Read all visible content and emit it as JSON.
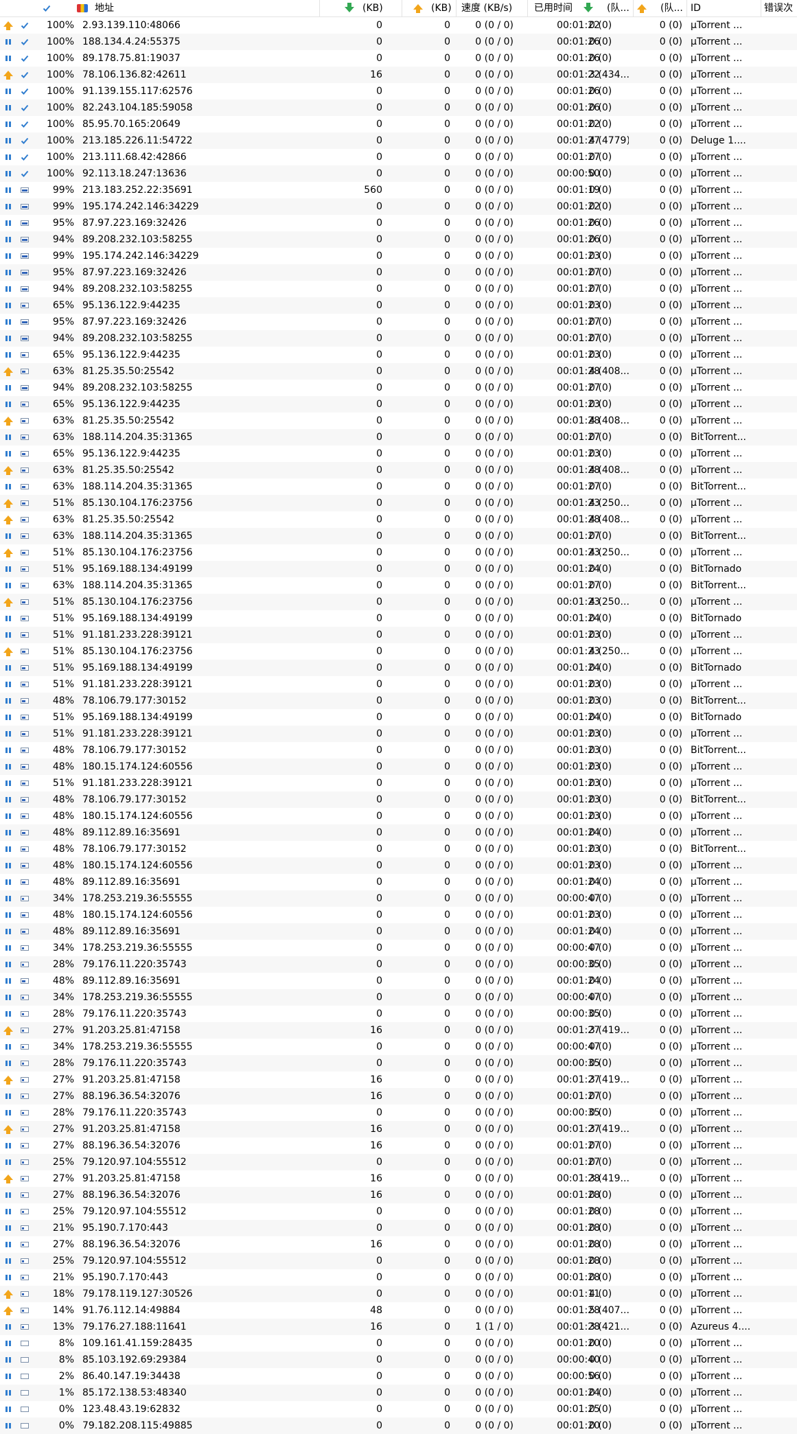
{
  "header": {
    "address": "地址",
    "down_kb": "(KB)",
    "up_kb": "(KB)",
    "speed": "速度 (KB/s)",
    "elapsed": "已用时间",
    "down_queue": "(队...",
    "up_queue": "(队...",
    "id": "ID",
    "errors": "错误次"
  },
  "rows": [
    [
      "up",
      "done",
      "100%",
      "2.93.139.110:48066",
      "0",
      "0",
      "0 (0 / 0)",
      "00:01:22",
      "0 (0)",
      "0 (0)",
      "µTorrent ..."
    ],
    [
      "pause",
      "done",
      "100%",
      "188.134.4.24:55375",
      "0",
      "0",
      "0 (0 / 0)",
      "00:01:26",
      "0 (0)",
      "0 (0)",
      "µTorrent ..."
    ],
    [
      "pause",
      "done",
      "100%",
      "89.178.75.81:19037",
      "0",
      "0",
      "0 (0 / 0)",
      "00:01:26",
      "0 (0)",
      "0 (0)",
      "µTorrent ..."
    ],
    [
      "up",
      "done",
      "100%",
      "78.106.136.82:42611",
      "16",
      "0",
      "0 (0 / 0)",
      "00:01:22",
      "3 (434...",
      "0 (0)",
      "µTorrent ..."
    ],
    [
      "pause",
      "done",
      "100%",
      "91.139.155.117:62576",
      "0",
      "0",
      "0 (0 / 0)",
      "00:01:26",
      "0 (0)",
      "0 (0)",
      "µTorrent ..."
    ],
    [
      "pause",
      "done",
      "100%",
      "82.243.104.185:59058",
      "0",
      "0",
      "0 (0 / 0)",
      "00:01:26",
      "0 (0)",
      "0 (0)",
      "µTorrent ..."
    ],
    [
      "pause",
      "done",
      "100%",
      "85.95.70.165:20649",
      "0",
      "0",
      "0 (0 / 0)",
      "00:01:22",
      "0 (0)",
      "0 (0)",
      "µTorrent ..."
    ],
    [
      "pause",
      "done",
      "100%",
      "213.185.226.11:54722",
      "0",
      "0",
      "0 (0 / 0)",
      "00:01:27",
      "4 (4779)",
      "0 (0)",
      "Deluge 1...."
    ],
    [
      "pause",
      "done",
      "100%",
      "213.111.68.42:42866",
      "0",
      "0",
      "0 (0 / 0)",
      "00:01:27",
      "0 (0)",
      "0 (0)",
      "µTorrent ..."
    ],
    [
      "pause",
      "done",
      "100%",
      "92.113.18.247:13636",
      "0",
      "0",
      "0 (0 / 0)",
      "00:00:50",
      "0 (0)",
      "0 (0)",
      "µTorrent ..."
    ],
    [
      "pause",
      "part",
      "99%",
      "213.183.252.22:35691",
      "560",
      "0",
      "0 (0 / 0)",
      "00:01:19",
      "0 (0)",
      "0 (0)",
      "µTorrent ..."
    ],
    [
      "pause",
      "part",
      "99%",
      "195.174.242.146:34229",
      "0",
      "0",
      "0 (0 / 0)",
      "00:01:22",
      "0 (0)",
      "0 (0)",
      "µTorrent ..."
    ],
    [
      "pause",
      "part",
      "95%",
      "87.97.223.169:32426",
      "0",
      "0",
      "0 (0 / 0)",
      "00:01:26",
      "0 (0)",
      "0 (0)",
      "µTorrent ..."
    ],
    [
      "pause",
      "part",
      "94%",
      "89.208.232.103:58255",
      "0",
      "0",
      "0 (0 / 0)",
      "00:01:26",
      "0 (0)",
      "0 (0)",
      "µTorrent ..."
    ],
    [
      "pause",
      "part",
      "99%",
      "195.174.242.146:34229",
      "0",
      "0",
      "0 (0 / 0)",
      "00:01:23",
      "0 (0)",
      "0 (0)",
      "µTorrent ..."
    ],
    [
      "pause",
      "part",
      "95%",
      "87.97.223.169:32426",
      "0",
      "0",
      "0 (0 / 0)",
      "00:01:27",
      "0 (0)",
      "0 (0)",
      "µTorrent ..."
    ],
    [
      "pause",
      "part",
      "94%",
      "89.208.232.103:58255",
      "0",
      "0",
      "0 (0 / 0)",
      "00:01:27",
      "0 (0)",
      "0 (0)",
      "µTorrent ..."
    ],
    [
      "pause",
      "mid",
      "65%",
      "95.136.122.9:44235",
      "0",
      "0",
      "0 (0 / 0)",
      "00:01:23",
      "0 (0)",
      "0 (0)",
      "µTorrent ..."
    ],
    [
      "pause",
      "part",
      "95%",
      "87.97.223.169:32426",
      "0",
      "0",
      "0 (0 / 0)",
      "00:01:27",
      "0 (0)",
      "0 (0)",
      "µTorrent ..."
    ],
    [
      "pause",
      "part",
      "94%",
      "89.208.232.103:58255",
      "0",
      "0",
      "0 (0 / 0)",
      "00:01:27",
      "0 (0)",
      "0 (0)",
      "µTorrent ..."
    ],
    [
      "pause",
      "mid",
      "65%",
      "95.136.122.9:44235",
      "0",
      "0",
      "0 (0 / 0)",
      "00:01:23",
      "0 (0)",
      "0 (0)",
      "µTorrent ..."
    ],
    [
      "up",
      "mid",
      "63%",
      "81.25.35.50:25542",
      "0",
      "0",
      "0 (0 / 0)",
      "00:01:28",
      "4 (408...",
      "0 (0)",
      "µTorrent ..."
    ],
    [
      "pause",
      "part",
      "94%",
      "89.208.232.103:58255",
      "0",
      "0",
      "0 (0 / 0)",
      "00:01:27",
      "0 (0)",
      "0 (0)",
      "µTorrent ..."
    ],
    [
      "pause",
      "mid",
      "65%",
      "95.136.122.9:44235",
      "0",
      "0",
      "0 (0 / 0)",
      "00:01:23",
      "0 (0)",
      "0 (0)",
      "µTorrent ..."
    ],
    [
      "up",
      "mid",
      "63%",
      "81.25.35.50:25542",
      "0",
      "0",
      "0 (0 / 0)",
      "00:01:28",
      "4 (408...",
      "0 (0)",
      "µTorrent ..."
    ],
    [
      "pause",
      "mid",
      "63%",
      "188.114.204.35:31365",
      "0",
      "0",
      "0 (0 / 0)",
      "00:01:27",
      "0 (0)",
      "0 (0)",
      "BitTorrent..."
    ],
    [
      "pause",
      "mid",
      "65%",
      "95.136.122.9:44235",
      "0",
      "0",
      "0 (0 / 0)",
      "00:01:23",
      "0 (0)",
      "0 (0)",
      "µTorrent ..."
    ],
    [
      "up",
      "mid",
      "63%",
      "81.25.35.50:25542",
      "0",
      "0",
      "0 (0 / 0)",
      "00:01:28",
      "4 (408...",
      "0 (0)",
      "µTorrent ..."
    ],
    [
      "pause",
      "mid",
      "63%",
      "188.114.204.35:31365",
      "0",
      "0",
      "0 (0 / 0)",
      "00:01:27",
      "0 (0)",
      "0 (0)",
      "BitTorrent..."
    ],
    [
      "up",
      "mid",
      "51%",
      "85.130.104.176:23756",
      "0",
      "0",
      "0 (0 / 0)",
      "00:01:23",
      "4 (250...",
      "0 (0)",
      "µTorrent ..."
    ],
    [
      "up",
      "mid",
      "63%",
      "81.25.35.50:25542",
      "0",
      "0",
      "0 (0 / 0)",
      "00:01:28",
      "4 (408...",
      "0 (0)",
      "µTorrent ..."
    ],
    [
      "pause",
      "mid",
      "63%",
      "188.114.204.35:31365",
      "0",
      "0",
      "0 (0 / 0)",
      "00:01:27",
      "0 (0)",
      "0 (0)",
      "BitTorrent..."
    ],
    [
      "up",
      "mid",
      "51%",
      "85.130.104.176:23756",
      "0",
      "0",
      "0 (0 / 0)",
      "00:01:23",
      "4 (250...",
      "0 (0)",
      "µTorrent ..."
    ],
    [
      "pause",
      "mid",
      "51%",
      "95.169.188.134:49199",
      "0",
      "0",
      "0 (0 / 0)",
      "00:01:24",
      "0 (0)",
      "0 (0)",
      "BitTornado"
    ],
    [
      "pause",
      "mid",
      "63%",
      "188.114.204.35:31365",
      "0",
      "0",
      "0 (0 / 0)",
      "00:01:27",
      "0 (0)",
      "0 (0)",
      "BitTorrent..."
    ],
    [
      "up",
      "mid",
      "51%",
      "85.130.104.176:23756",
      "0",
      "0",
      "0 (0 / 0)",
      "00:01:23",
      "4 (250...",
      "0 (0)",
      "µTorrent ..."
    ],
    [
      "pause",
      "mid",
      "51%",
      "95.169.188.134:49199",
      "0",
      "0",
      "0 (0 / 0)",
      "00:01:24",
      "0 (0)",
      "0 (0)",
      "BitTornado"
    ],
    [
      "pause",
      "mid",
      "51%",
      "91.181.233.228:39121",
      "0",
      "0",
      "0 (0 / 0)",
      "00:01:23",
      "0 (0)",
      "0 (0)",
      "µTorrent ..."
    ],
    [
      "up",
      "mid",
      "51%",
      "85.130.104.176:23756",
      "0",
      "0",
      "0 (0 / 0)",
      "00:01:23",
      "4 (250...",
      "0 (0)",
      "µTorrent ..."
    ],
    [
      "pause",
      "mid",
      "51%",
      "95.169.188.134:49199",
      "0",
      "0",
      "0 (0 / 0)",
      "00:01:24",
      "0 (0)",
      "0 (0)",
      "BitTornado"
    ],
    [
      "pause",
      "mid",
      "51%",
      "91.181.233.228:39121",
      "0",
      "0",
      "0 (0 / 0)",
      "00:01:23",
      "0 (0)",
      "0 (0)",
      "µTorrent ..."
    ],
    [
      "pause",
      "mid",
      "48%",
      "78.106.79.177:30152",
      "0",
      "0",
      "0 (0 / 0)",
      "00:01:23",
      "0 (0)",
      "0 (0)",
      "BitTorrent..."
    ],
    [
      "pause",
      "mid",
      "51%",
      "95.169.188.134:49199",
      "0",
      "0",
      "0 (0 / 0)",
      "00:01:24",
      "0 (0)",
      "0 (0)",
      "BitTornado"
    ],
    [
      "pause",
      "mid",
      "51%",
      "91.181.233.228:39121",
      "0",
      "0",
      "0 (0 / 0)",
      "00:01:23",
      "0 (0)",
      "0 (0)",
      "µTorrent ..."
    ],
    [
      "pause",
      "mid",
      "48%",
      "78.106.79.177:30152",
      "0",
      "0",
      "0 (0 / 0)",
      "00:01:23",
      "0 (0)",
      "0 (0)",
      "BitTorrent..."
    ],
    [
      "pause",
      "mid",
      "48%",
      "180.15.174.124:60556",
      "0",
      "0",
      "0 (0 / 0)",
      "00:01:23",
      "0 (0)",
      "0 (0)",
      "µTorrent ..."
    ],
    [
      "pause",
      "mid",
      "51%",
      "91.181.233.228:39121",
      "0",
      "0",
      "0 (0 / 0)",
      "00:01:23",
      "0 (0)",
      "0 (0)",
      "µTorrent ..."
    ],
    [
      "pause",
      "mid",
      "48%",
      "78.106.79.177:30152",
      "0",
      "0",
      "0 (0 / 0)",
      "00:01:23",
      "0 (0)",
      "0 (0)",
      "BitTorrent..."
    ],
    [
      "pause",
      "mid",
      "48%",
      "180.15.174.124:60556",
      "0",
      "0",
      "0 (0 / 0)",
      "00:01:23",
      "0 (0)",
      "0 (0)",
      "µTorrent ..."
    ],
    [
      "pause",
      "mid",
      "48%",
      "89.112.89.16:35691",
      "0",
      "0",
      "0 (0 / 0)",
      "00:01:24",
      "0 (0)",
      "0 (0)",
      "µTorrent ..."
    ],
    [
      "pause",
      "mid",
      "48%",
      "78.106.79.177:30152",
      "0",
      "0",
      "0 (0 / 0)",
      "00:01:23",
      "0 (0)",
      "0 (0)",
      "BitTorrent..."
    ],
    [
      "pause",
      "mid",
      "48%",
      "180.15.174.124:60556",
      "0",
      "0",
      "0 (0 / 0)",
      "00:01:23",
      "0 (0)",
      "0 (0)",
      "µTorrent ..."
    ],
    [
      "pause",
      "mid",
      "48%",
      "89.112.89.16:35691",
      "0",
      "0",
      "0 (0 / 0)",
      "00:01:24",
      "0 (0)",
      "0 (0)",
      "µTorrent ..."
    ],
    [
      "pause",
      "low",
      "34%",
      "178.253.219.36:55555",
      "0",
      "0",
      "0 (0 / 0)",
      "00:00:47",
      "0 (0)",
      "0 (0)",
      "µTorrent ..."
    ],
    [
      "pause",
      "mid",
      "48%",
      "180.15.174.124:60556",
      "0",
      "0",
      "0 (0 / 0)",
      "00:01:23",
      "0 (0)",
      "0 (0)",
      "µTorrent ..."
    ],
    [
      "pause",
      "mid",
      "48%",
      "89.112.89.16:35691",
      "0",
      "0",
      "0 (0 / 0)",
      "00:01:24",
      "0 (0)",
      "0 (0)",
      "µTorrent ..."
    ],
    [
      "pause",
      "low",
      "34%",
      "178.253.219.36:55555",
      "0",
      "0",
      "0 (0 / 0)",
      "00:00:47",
      "0 (0)",
      "0 (0)",
      "µTorrent ..."
    ],
    [
      "pause",
      "low",
      "28%",
      "79.176.11.220:35743",
      "0",
      "0",
      "0 (0 / 0)",
      "00:00:35",
      "0 (0)",
      "0 (0)",
      "µTorrent ..."
    ],
    [
      "pause",
      "mid",
      "48%",
      "89.112.89.16:35691",
      "0",
      "0",
      "0 (0 / 0)",
      "00:01:24",
      "0 (0)",
      "0 (0)",
      "µTorrent ..."
    ],
    [
      "pause",
      "low",
      "34%",
      "178.253.219.36:55555",
      "0",
      "0",
      "0 (0 / 0)",
      "00:00:47",
      "0 (0)",
      "0 (0)",
      "µTorrent ..."
    ],
    [
      "pause",
      "low",
      "28%",
      "79.176.11.220:35743",
      "0",
      "0",
      "0 (0 / 0)",
      "00:00:35",
      "0 (0)",
      "0 (0)",
      "µTorrent ..."
    ],
    [
      "up",
      "low",
      "27%",
      "91.203.25.81:47158",
      "16",
      "0",
      "0 (0 / 0)",
      "00:01:27",
      "3 (419...",
      "0 (0)",
      "µTorrent ..."
    ],
    [
      "pause",
      "low",
      "34%",
      "178.253.219.36:55555",
      "0",
      "0",
      "0 (0 / 0)",
      "00:00:47",
      "0 (0)",
      "0 (0)",
      "µTorrent ..."
    ],
    [
      "pause",
      "low",
      "28%",
      "79.176.11.220:35743",
      "0",
      "0",
      "0 (0 / 0)",
      "00:00:35",
      "0 (0)",
      "0 (0)",
      "µTorrent ..."
    ],
    [
      "up",
      "low",
      "27%",
      "91.203.25.81:47158",
      "16",
      "0",
      "0 (0 / 0)",
      "00:01:27",
      "3 (419...",
      "0 (0)",
      "µTorrent ..."
    ],
    [
      "pause",
      "low",
      "27%",
      "88.196.36.54:32076",
      "16",
      "0",
      "0 (0 / 0)",
      "00:01:27",
      "0 (0)",
      "0 (0)",
      "µTorrent ..."
    ],
    [
      "pause",
      "low",
      "28%",
      "79.176.11.220:35743",
      "0",
      "0",
      "0 (0 / 0)",
      "00:00:35",
      "0 (0)",
      "0 (0)",
      "µTorrent ..."
    ],
    [
      "up",
      "low",
      "27%",
      "91.203.25.81:47158",
      "16",
      "0",
      "0 (0 / 0)",
      "00:01:27",
      "3 (419...",
      "0 (0)",
      "µTorrent ..."
    ],
    [
      "pause",
      "low",
      "27%",
      "88.196.36.54:32076",
      "16",
      "0",
      "0 (0 / 0)",
      "00:01:27",
      "0 (0)",
      "0 (0)",
      "µTorrent ..."
    ],
    [
      "pause",
      "low",
      "25%",
      "79.120.97.104:55512",
      "0",
      "0",
      "0 (0 / 0)",
      "00:01:27",
      "0 (0)",
      "0 (0)",
      "µTorrent ..."
    ],
    [
      "up",
      "low",
      "27%",
      "91.203.25.81:47158",
      "16",
      "0",
      "0 (0 / 0)",
      "00:01:28",
      "3 (419...",
      "0 (0)",
      "µTorrent ..."
    ],
    [
      "pause",
      "low",
      "27%",
      "88.196.36.54:32076",
      "16",
      "0",
      "0 (0 / 0)",
      "00:01:28",
      "0 (0)",
      "0 (0)",
      "µTorrent ..."
    ],
    [
      "pause",
      "low",
      "25%",
      "79.120.97.104:55512",
      "0",
      "0",
      "0 (0 / 0)",
      "00:01:28",
      "0 (0)",
      "0 (0)",
      "µTorrent ..."
    ],
    [
      "pause",
      "low",
      "21%",
      "95.190.7.170:443",
      "0",
      "0",
      "0 (0 / 0)",
      "00:01:28",
      "0 (0)",
      "0 (0)",
      "µTorrent ..."
    ],
    [
      "pause",
      "low",
      "27%",
      "88.196.36.54:32076",
      "16",
      "0",
      "0 (0 / 0)",
      "00:01:28",
      "0 (0)",
      "0 (0)",
      "µTorrent ..."
    ],
    [
      "pause",
      "low",
      "25%",
      "79.120.97.104:55512",
      "0",
      "0",
      "0 (0 / 0)",
      "00:01:28",
      "0 (0)",
      "0 (0)",
      "µTorrent ..."
    ],
    [
      "pause",
      "low",
      "21%",
      "95.190.7.170:443",
      "0",
      "0",
      "0 (0 / 0)",
      "00:01:28",
      "0 (0)",
      "0 (0)",
      "µTorrent ..."
    ],
    [
      "up",
      "low",
      "18%",
      "79.178.119.127:30526",
      "0",
      "0",
      "0 (0 / 0)",
      "00:01:11",
      "4 (0)",
      "0 (0)",
      "µTorrent ..."
    ],
    [
      "up",
      "low",
      "14%",
      "91.76.112.14:49884",
      "48",
      "0",
      "0 (0 / 0)",
      "00:01:28",
      "5 (407...",
      "0 (0)",
      "µTorrent ..."
    ],
    [
      "pause",
      "low",
      "13%",
      "79.176.27.188:11641",
      "16",
      "0",
      "1 (1 / 0)",
      "00:01:28",
      "3 (421...",
      "0 (0)",
      "Azureus 4...."
    ],
    [
      "pause",
      "empty",
      "8%",
      "109.161.41.159:28435",
      "0",
      "0",
      "0 (0 / 0)",
      "00:01:20",
      "0 (0)",
      "0 (0)",
      "µTorrent ..."
    ],
    [
      "pause",
      "empty",
      "8%",
      "85.103.192.69:29384",
      "0",
      "0",
      "0 (0 / 0)",
      "00:00:40",
      "0 (0)",
      "0 (0)",
      "µTorrent ..."
    ],
    [
      "pause",
      "empty",
      "2%",
      "86.40.147.19:34438",
      "0",
      "0",
      "0 (0 / 0)",
      "00:00:56",
      "0 (0)",
      "0 (0)",
      "µTorrent ..."
    ],
    [
      "pause",
      "empty",
      "1%",
      "85.172.138.53:48340",
      "0",
      "0",
      "0 (0 / 0)",
      "00:01:24",
      "0 (0)",
      "0 (0)",
      "µTorrent ..."
    ],
    [
      "pause",
      "empty",
      "0%",
      "123.48.43.19:62832",
      "0",
      "0",
      "0 (0 / 0)",
      "00:01:25",
      "0 (0)",
      "0 (0)",
      "µTorrent ..."
    ],
    [
      "pause",
      "empty",
      "0%",
      "79.182.208.115:49885",
      "0",
      "0",
      "0 (0 / 0)",
      "00:01:20",
      "0 (0)",
      "0 (0)",
      "µTorrent ..."
    ]
  ],
  "icons": {
    "header_progress": "check-icon",
    "header_address": "flag-icon",
    "header_down": "down-arrow-icon",
    "header_up": "up-arrow-icon",
    "row_pause": "pause-icon",
    "row_upload": "up-arrow-icon",
    "row_done": "check-icon",
    "row_partial": "block-icon"
  },
  "colors": {
    "accent_blue": "#2f7dcf",
    "upload_orange": "#f2a51a",
    "download_green": "#33a853",
    "row_alt": "#f7f7f7"
  }
}
